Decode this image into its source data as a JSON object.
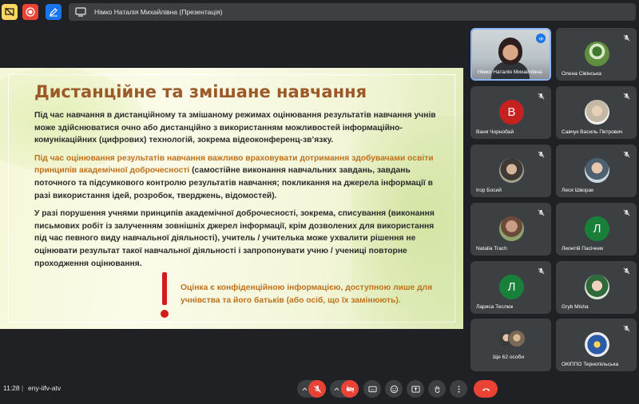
{
  "topbar": {
    "presenter_label": "Німко Наталія Михайлівна (Презентація)"
  },
  "slide": {
    "title": "Дистанційне та змішане навчання",
    "p1": "Під час навчання в дистанційному та змішаному режимах оцінювання результатів навчання учнів може здійснюватися очно або дистанційно з використанням можливостей інформаційно-комунікаційних (цифрових) технологій, зокрема відеоконференц-зв’язку.",
    "p2_highlight": "Під час оцінювання результатів навчання важливо враховувати дотримання здобувачами освіти принципів академічної доброчесності",
    "p2_rest": " (самостійне виконання навчальних завдань, завдань поточного та підсумкового контролю результатів навчання; покликання на джерела інформації в разі використання ідей, розробок, тверджень, відомостей).",
    "p3": "У разі порушення учнями принципів академічної доброчесності, зокрема, списування (виконання письмових робіт із залученням зовнішніх джерел інформації, крім дозволених для використання під час певного виду навчальної діяльності), учитель / учителька може ухвалити рішення не оцінювати результат такої навчальної діяльності і запропонувати учню / учениці повторне проходження оцінювання.",
    "note": "Оцінка є конфіденційною інформацією, доступною лише для учнівства та його батьків (або осіб, що їх замінюють)."
  },
  "participants": [
    {
      "name": "Німко Наталія Михайлівна",
      "initial": ""
    },
    {
      "name": "Олена Сівінська",
      "initial": ""
    },
    {
      "name": "Ваня Чорнобай",
      "initial": "В",
      "color": "#c5221f"
    },
    {
      "name": "Савчук Василь Петрович",
      "initial": ""
    },
    {
      "name": "Ігор Босий",
      "initial": ""
    },
    {
      "name": "Леся Шворак",
      "initial": ""
    },
    {
      "name": "Natalia Trach",
      "initial": ""
    },
    {
      "name": "Леонтій Пасічник",
      "initial": "Л",
      "color": "#188038"
    },
    {
      "name": "Лариса Теслюк",
      "initial": "Л",
      "color": "#188038"
    },
    {
      "name": "Gryb Misha",
      "initial": ""
    },
    {
      "name": "Ще 62 особи",
      "initial": ""
    },
    {
      "name": "ОКІППО Тернопільська",
      "initial": ""
    }
  ],
  "bottombar": {
    "time": "11:28",
    "separator": "|",
    "meeting_code": "eny-iifv-atv"
  },
  "colors": {
    "background": "#202124",
    "tile": "#3c4043",
    "hangup": "#ea4335",
    "slide_title": "#9c5a29",
    "slide_accent": "#c0711c"
  }
}
